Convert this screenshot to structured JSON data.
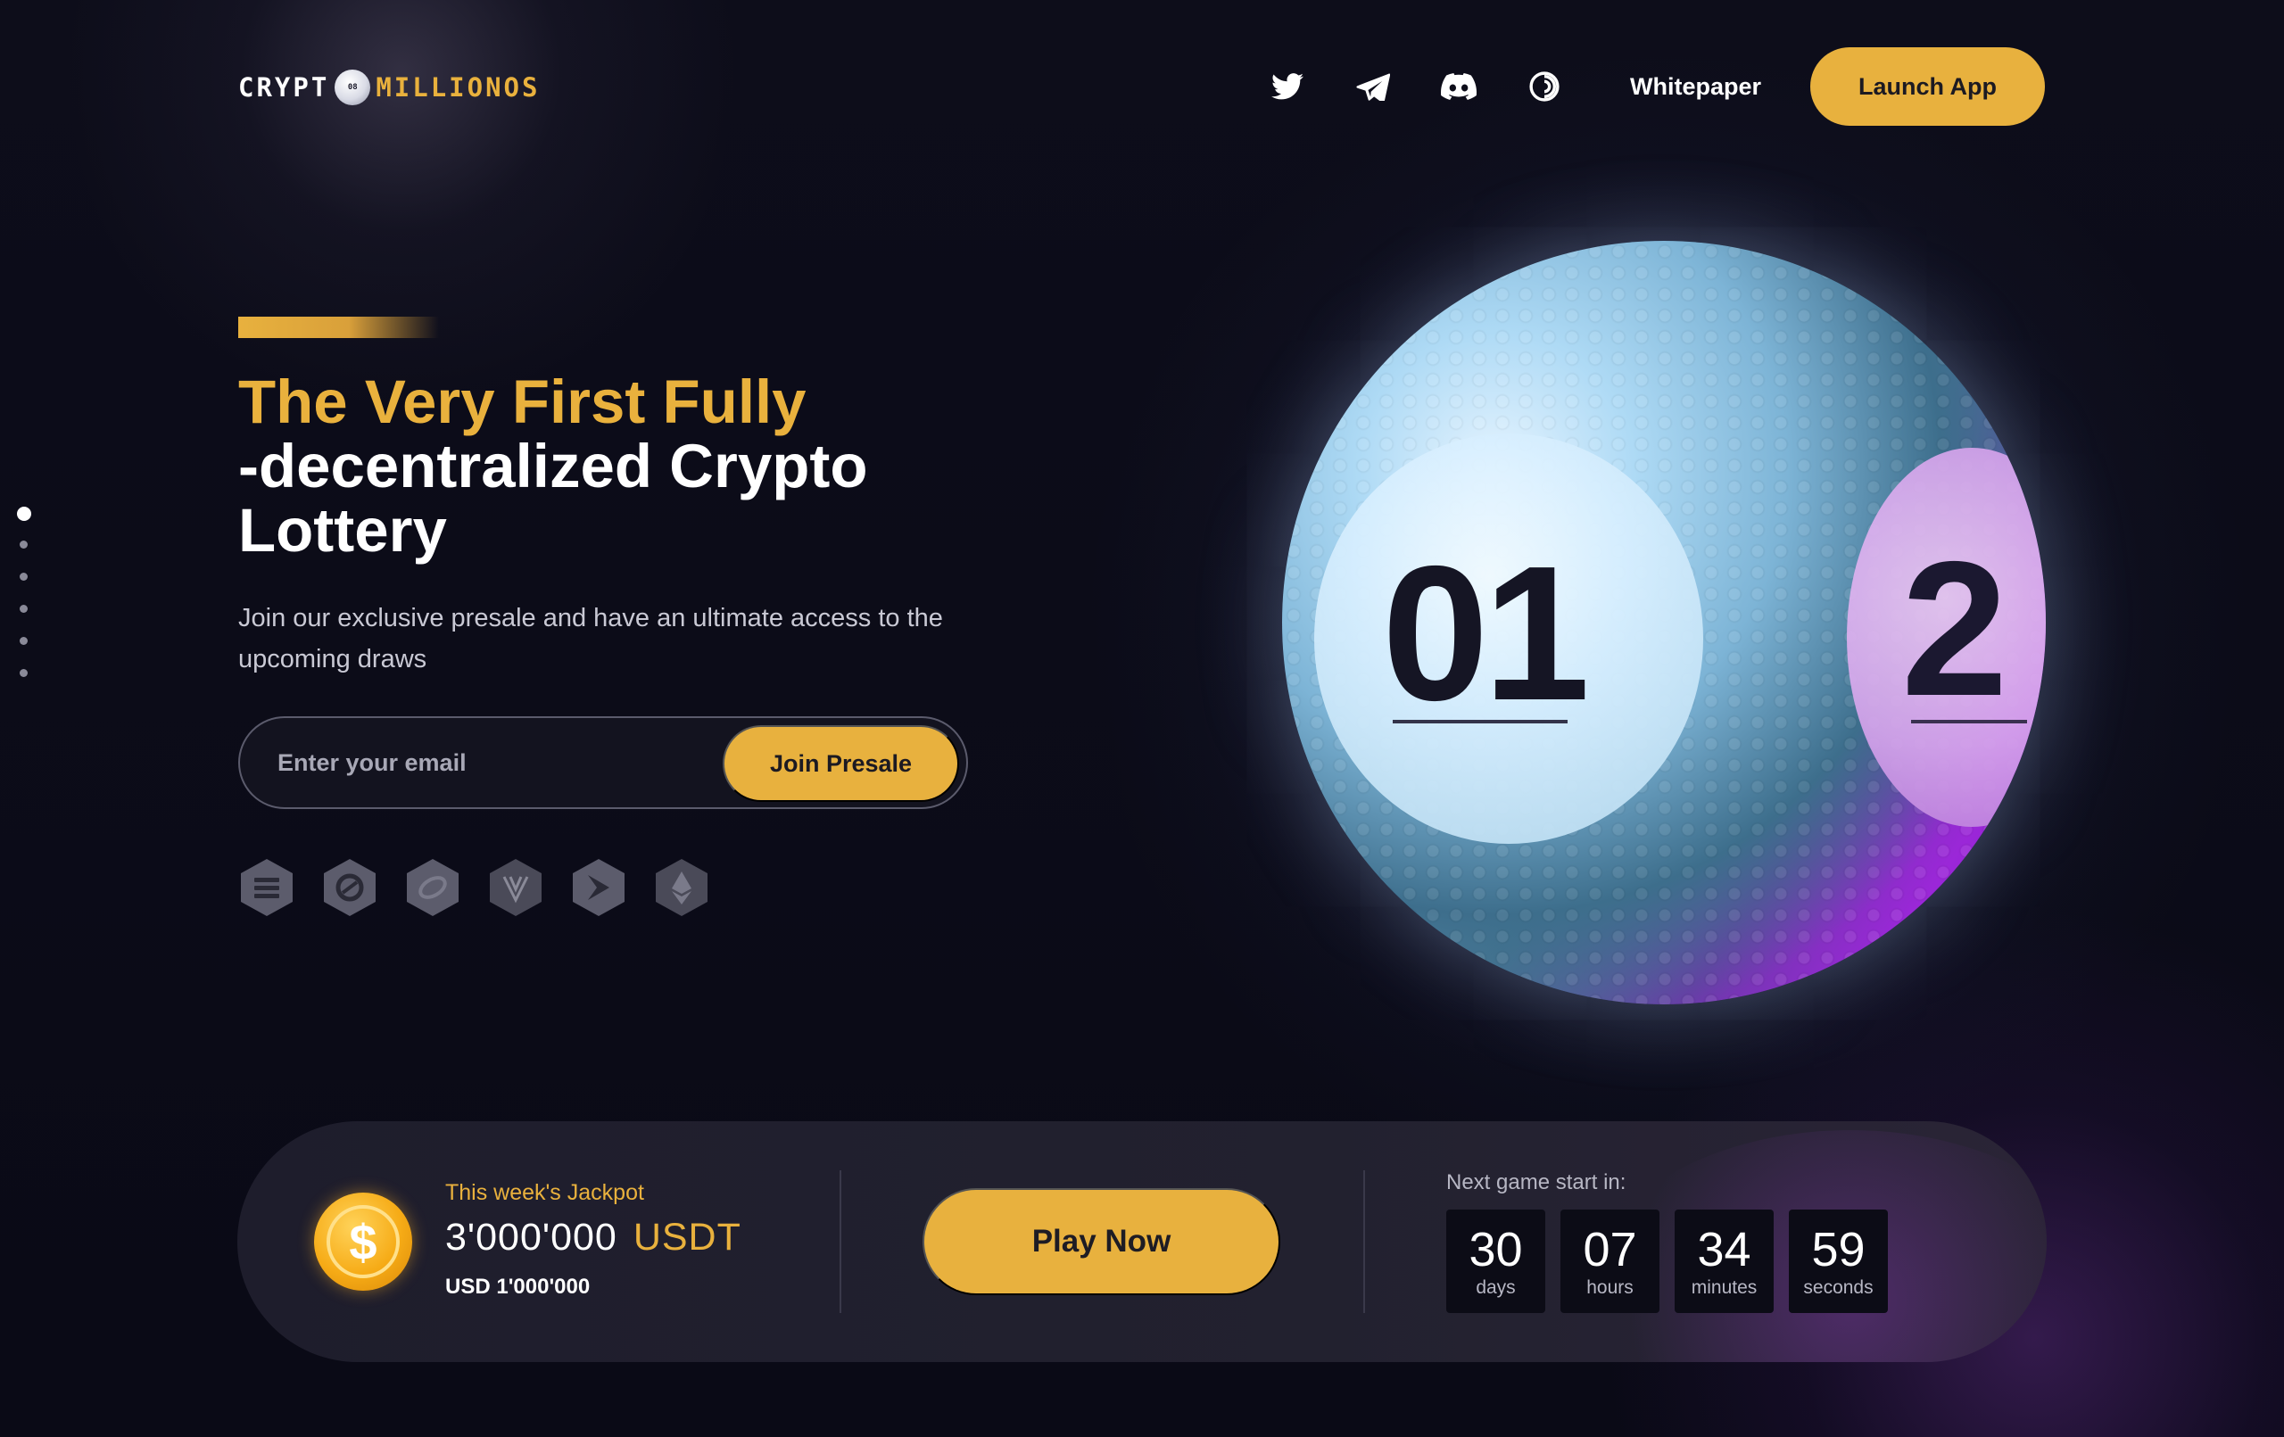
{
  "header": {
    "logo": {
      "part1": "CRYPT",
      "ball_text": "08",
      "part2": "MILLIONOS"
    },
    "social_icons": [
      "twitter-icon",
      "telegram-icon",
      "discord-icon",
      "coinmarketcap-icon"
    ],
    "whitepaper_label": "Whitepaper",
    "launch_label": "Launch App"
  },
  "slider": {
    "count": 6,
    "active_index": 0
  },
  "hero": {
    "title_line1": "The Very First Fully",
    "title_line2": "-decentralized Crypto",
    "title_line3": "Lottery",
    "subtitle": "Join our exclusive presale and have an ultimate access to the upcoming draws",
    "email_placeholder": "Enter your email",
    "join_label": "Join Presale",
    "chain_icons": [
      "solana-icon",
      "chain-2-icon",
      "chain-3-icon",
      "velas-icon",
      "chain-5-icon",
      "ethereum-icon"
    ]
  },
  "ball": {
    "number_main": "01",
    "number_side": "2"
  },
  "jackpot": {
    "label": "This week's Jackpot",
    "amount": "3'000'000",
    "currency": "USDT",
    "usd": "USD 1'000'000",
    "play_label": "Play Now"
  },
  "countdown": {
    "label": "Next game start in:",
    "days": "30",
    "days_label": "days",
    "hours": "07",
    "hours_label": "hours",
    "minutes": "34",
    "minutes_label": "minutes",
    "seconds": "59",
    "seconds_label": "seconds"
  },
  "colors": {
    "accent": "#e8b13e",
    "background": "#0b0b17",
    "purple": "#9b27d8"
  }
}
